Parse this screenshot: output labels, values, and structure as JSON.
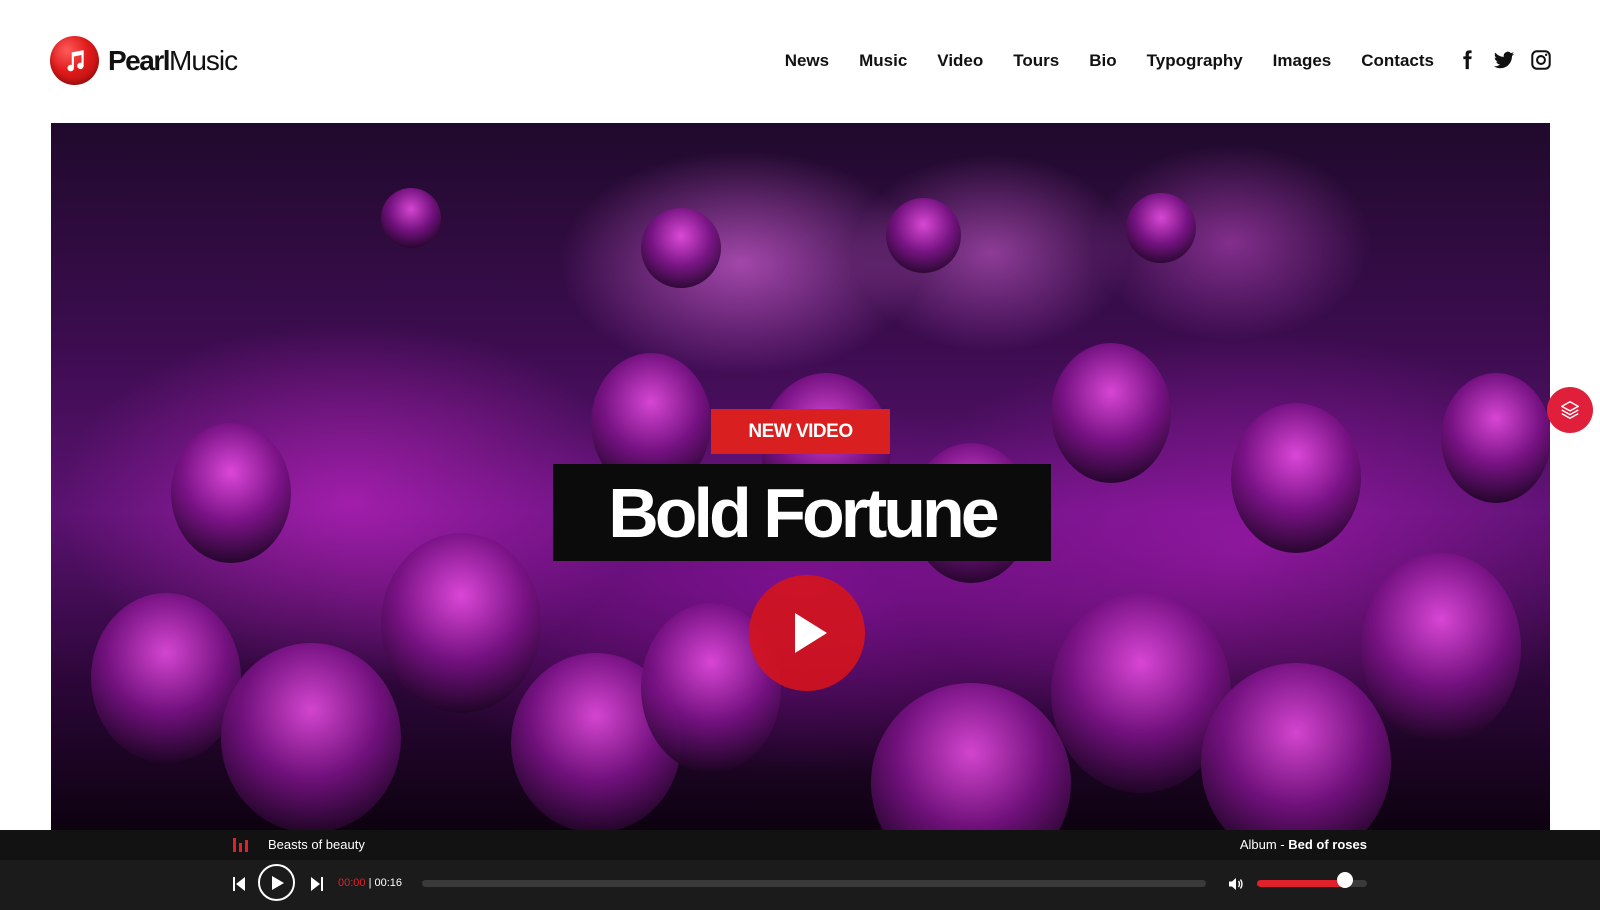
{
  "brand": {
    "name_bold": "Pearl",
    "name_light": "Music",
    "icon": "music-note-icon",
    "accent": "#e01a1a"
  },
  "nav": {
    "items": [
      {
        "label": "News"
      },
      {
        "label": "Music"
      },
      {
        "label": "Video"
      },
      {
        "label": "Tours"
      },
      {
        "label": "Bio"
      },
      {
        "label": "Typography"
      },
      {
        "label": "Images"
      },
      {
        "label": "Contacts"
      }
    ],
    "social": [
      "facebook-icon",
      "twitter-icon",
      "instagram-icon"
    ]
  },
  "hero": {
    "badge": "NEW VIDEO",
    "title": "Bold Fortune",
    "play_icon": "play-icon",
    "side_button_icon": "layers-icon"
  },
  "player": {
    "track": "Beasts of beauty",
    "album_prefix": "Album - ",
    "album_name": "Bed of roses",
    "current_time": "00:00",
    "separator": " | ",
    "duration": "00:16",
    "progress": 0,
    "volume": 0.8,
    "colors": {
      "accent": "#e0202a",
      "bar_bg": "#121212",
      "controls_bg": "#1b1b1b"
    }
  }
}
